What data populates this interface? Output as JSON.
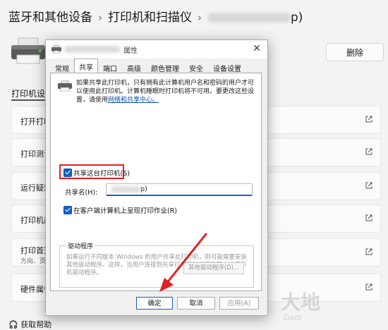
{
  "breadcrumb": {
    "item1": "蓝牙和其他设备",
    "item2": "打印机和扫描仪",
    "item3_tail": "p)"
  },
  "background": {
    "remove_label": "删除",
    "section_title": "打印机设置",
    "rows": [
      {
        "label": "打开打印"
      },
      {
        "label": "打印测试"
      },
      {
        "label": "运行疑难"
      },
      {
        "label": "打印机属"
      },
      {
        "label": "打印首选",
        "sub": "方向、页面"
      },
      {
        "label": "硬件属性"
      }
    ],
    "help": "获取帮助"
  },
  "dialog": {
    "title": "属性",
    "tabs": [
      "常规",
      "共享",
      "端口",
      "高级",
      "颜色管理",
      "安全",
      "设备设置"
    ],
    "active_tab": "共享",
    "share_desc": "如果共享此打印机，只有拥有此计算机用户名和密码的用户才可以使用此打印机。计算机睡眠时打印机将不可用。要更改这些设置，请使用",
    "share_link": "网络和共享中心。",
    "share_checkbox_label": "共享这台打印机(S)",
    "share_name_label": "共享名(H):",
    "share_name_tail": "p)",
    "render_checkbox_label": "在客户端计算机上呈现打印作业(R)",
    "drivers_title": "驱动程序",
    "drivers_desc": "如果运行不同版本 Windows 的用户共享此打印机，则可能需要安装其他驱动程序。这样，当用户连接到共享打印机时就不需要查找打印机驱动程序。",
    "drivers_button": "其他驱动程序(D)...",
    "ok": "确定",
    "cancel": "取消",
    "apply": "应用(A)"
  },
  "colors": {
    "accent": "#1561c5",
    "highlight": "#e02020"
  }
}
